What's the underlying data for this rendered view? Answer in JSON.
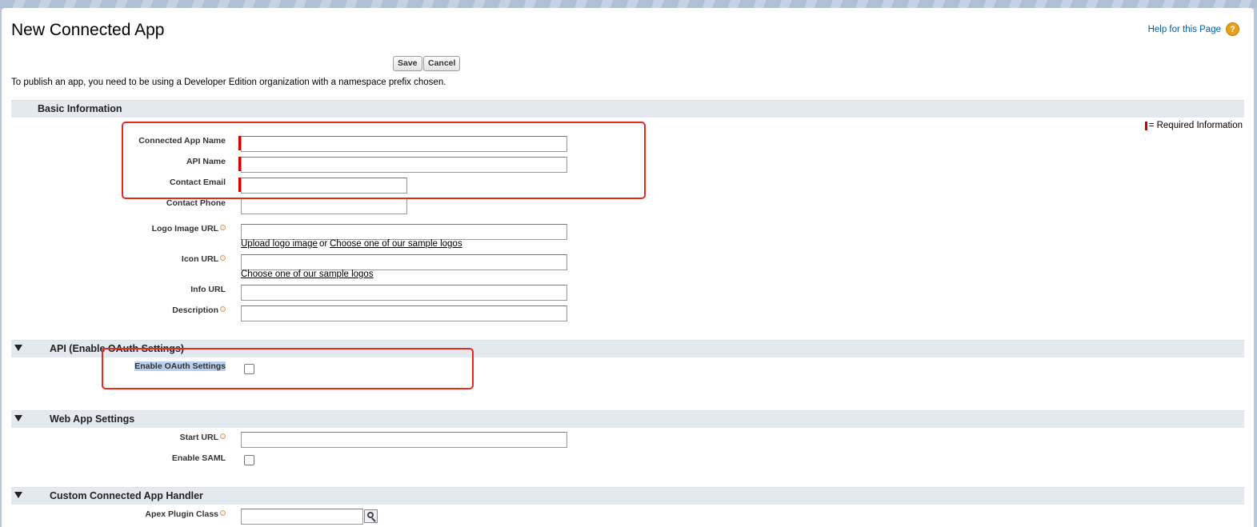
{
  "page": {
    "title": "New Connected App",
    "help_link": "Help for this Page",
    "help_icon": "?",
    "intro": "To publish an app, you need to be using a Developer Edition organization with a namespace prefix chosen.",
    "required_legend": "= Required Information"
  },
  "buttons": {
    "save": "Save",
    "cancel": "Cancel"
  },
  "basic_info": {
    "title": "Basic Information",
    "connected_app_name": {
      "label": "Connected App Name",
      "value": ""
    },
    "api_name": {
      "label": "API Name",
      "value": ""
    },
    "contact_email": {
      "label": "Contact Email",
      "value": ""
    },
    "contact_phone": {
      "label": "Contact Phone",
      "value": ""
    },
    "logo_url": {
      "label": "Logo Image URL",
      "value": ""
    },
    "logo_links": {
      "upload": "Upload logo image",
      "or": "or",
      "sample": "Choose one of our sample logos"
    },
    "icon_url": {
      "label": "Icon URL",
      "value": ""
    },
    "icon_links": {
      "sample": "Choose one of our sample logos"
    },
    "info_url": {
      "label": "Info URL",
      "value": ""
    },
    "description": {
      "label": "Description",
      "value": ""
    }
  },
  "oauth": {
    "title": "API (Enable OAuth Settings)",
    "enable_label": "Enable OAuth Settings",
    "enabled": false
  },
  "web_app": {
    "title": "Web App Settings",
    "start_url": {
      "label": "Start URL",
      "value": ""
    },
    "enable_saml_label": "Enable SAML",
    "saml_enabled": false
  },
  "handler": {
    "title": "Custom Connected App Handler",
    "apex_plugin_label": "Apex Plugin Class",
    "apex_plugin_value": ""
  },
  "colors": {
    "required": "#cc0000",
    "annotation": "#e8291c",
    "section_bg": "#e4e8ef"
  }
}
